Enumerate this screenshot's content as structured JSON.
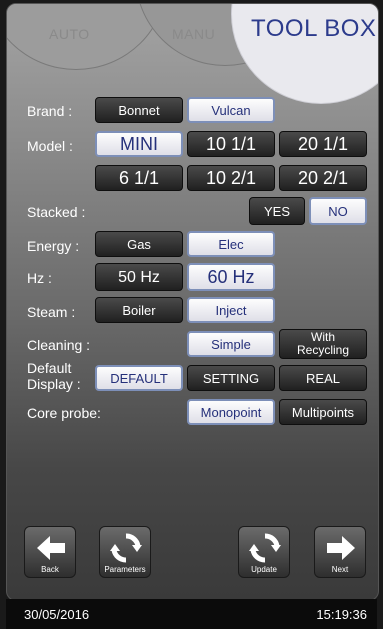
{
  "tabs": {
    "auto": "AUTO",
    "manu": "MANU",
    "toolbox": "TOOL BOX"
  },
  "rows": {
    "brand": {
      "label": "Brand :",
      "options": [
        "Bonnet",
        "Vulcan"
      ],
      "selected": "Vulcan"
    },
    "model": {
      "label": "Model :",
      "options": [
        "MINI",
        "10 1/1",
        "20 1/1",
        "6 1/1",
        "10 2/1",
        "20 2/1"
      ],
      "selected": "MINI"
    },
    "stacked": {
      "label": "Stacked :",
      "options": [
        "YES",
        "NO"
      ],
      "selected": "NO"
    },
    "energy": {
      "label": "Energy :",
      "options": [
        "Gas",
        "Elec"
      ],
      "selected": "Elec"
    },
    "hz": {
      "label": "Hz :",
      "options": [
        "50 Hz",
        "60 Hz"
      ],
      "selected": "60 Hz"
    },
    "steam": {
      "label": "Steam :",
      "options": [
        "Boiler",
        "Inject"
      ],
      "selected": "Inject"
    },
    "cleaning": {
      "label": "Cleaning :",
      "options": [
        "Simple",
        "With Recycling"
      ],
      "selected": "Simple"
    },
    "default_display": {
      "label_line1": "Default",
      "label_line2": "Display :",
      "options": [
        "DEFAULT",
        "SETTING",
        "REAL"
      ],
      "selected": "DEFAULT"
    },
    "core_probe": {
      "label": "Core probe:",
      "options": [
        "Monopoint",
        "Multipoints"
      ],
      "selected": "Monopoint"
    }
  },
  "nav": {
    "back": "Back",
    "parameters": "Parameters",
    "update": "Update",
    "next": "Next"
  },
  "status": {
    "date": "30/05/2016",
    "time": "15:19:36"
  },
  "colors": {
    "selected_text": "#25307a",
    "title": "#2c3b8c"
  }
}
